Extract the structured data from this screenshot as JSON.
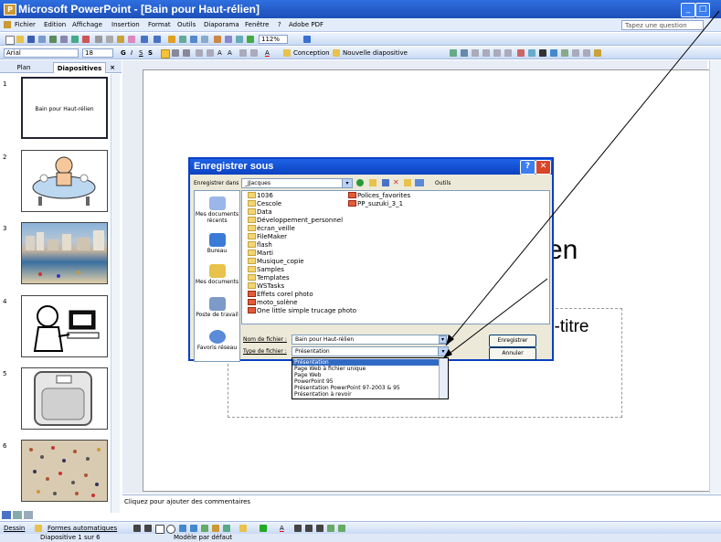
{
  "window": {
    "title": "Microsoft PowerPoint - [Bain pour Haut-rélien]",
    "icon": "ppt-app-icon"
  },
  "menu": {
    "items": [
      "Fichier",
      "Edition",
      "Affichage",
      "Insertion",
      "Format",
      "Outils",
      "Diaporama",
      "Fenêtre",
      "?",
      "Adobe PDF"
    ],
    "ask_placeholder": "Tapez une question"
  },
  "toolbar": {
    "zoom": "112%",
    "font_name": "Arial",
    "font_size": "18",
    "design_label": "Conception",
    "new_slide_label": "Nouvelle diapositive"
  },
  "panel": {
    "tab_plan": "Plan",
    "tab_slides": "Diapositives",
    "close": "×"
  },
  "slides": [
    {
      "num": "1",
      "title": "Bain pour Haut-rélien"
    },
    {
      "num": "2"
    },
    {
      "num": "3"
    },
    {
      "num": "4"
    },
    {
      "num": "5"
    },
    {
      "num": "6"
    }
  ],
  "slide_main": {
    "title_fragment": "en",
    "subtitle_fragment": "s-titre"
  },
  "notes_placeholder": "Cliquez pour ajouter des commentaires",
  "drawbar": {
    "draw_label": "Dessin",
    "autoshapes_label": "Formes automatiques"
  },
  "statusbar": {
    "slide_info": "Diapositive 1 sur 6",
    "design": "Modèle par défaut"
  },
  "dialog": {
    "title": "Enregistrer sous",
    "save_in_label": "Enregistrer dans :",
    "save_in_value": "_JJacques",
    "tools_label": "Outils",
    "places": [
      "Mes documents récents",
      "Bureau",
      "Mes documents",
      "Poste de travail",
      "Favoris réseau"
    ],
    "files_col1": [
      "1036",
      "Cescole",
      "Data",
      "Développement_personnel",
      "écran_veille",
      "FileMaker",
      "flash",
      "Marti",
      "Musique_copie",
      "Samples",
      "Templates",
      "WSTasks",
      "Effets corel photo",
      "moto_solène",
      "One little simple trucage photo"
    ],
    "files_col1_types": [
      "folder",
      "folder",
      "folder",
      "folder",
      "folder",
      "folder",
      "folder",
      "folder",
      "folder",
      "folder",
      "folder",
      "folder",
      "ppt",
      "ppt",
      "ppt"
    ],
    "files_col2": [
      "Polices_favorites",
      "PP_suzuki_3_1"
    ],
    "filename_label": "Nom de fichier :",
    "filename_value": "Bain pour Haut-rélien",
    "filetype_label": "Type de fichier :",
    "filetype_value": "Présentation",
    "save_button": "Enregistrer",
    "cancel_button": "Annuler",
    "type_options": [
      "Présentation",
      "Page Web à fichier unique",
      "Page Web",
      "PowerPoint 95",
      "Présentation PowerPoint 97-2003 & 95",
      "Présentation à revoir"
    ],
    "selected_type_index": 0
  }
}
